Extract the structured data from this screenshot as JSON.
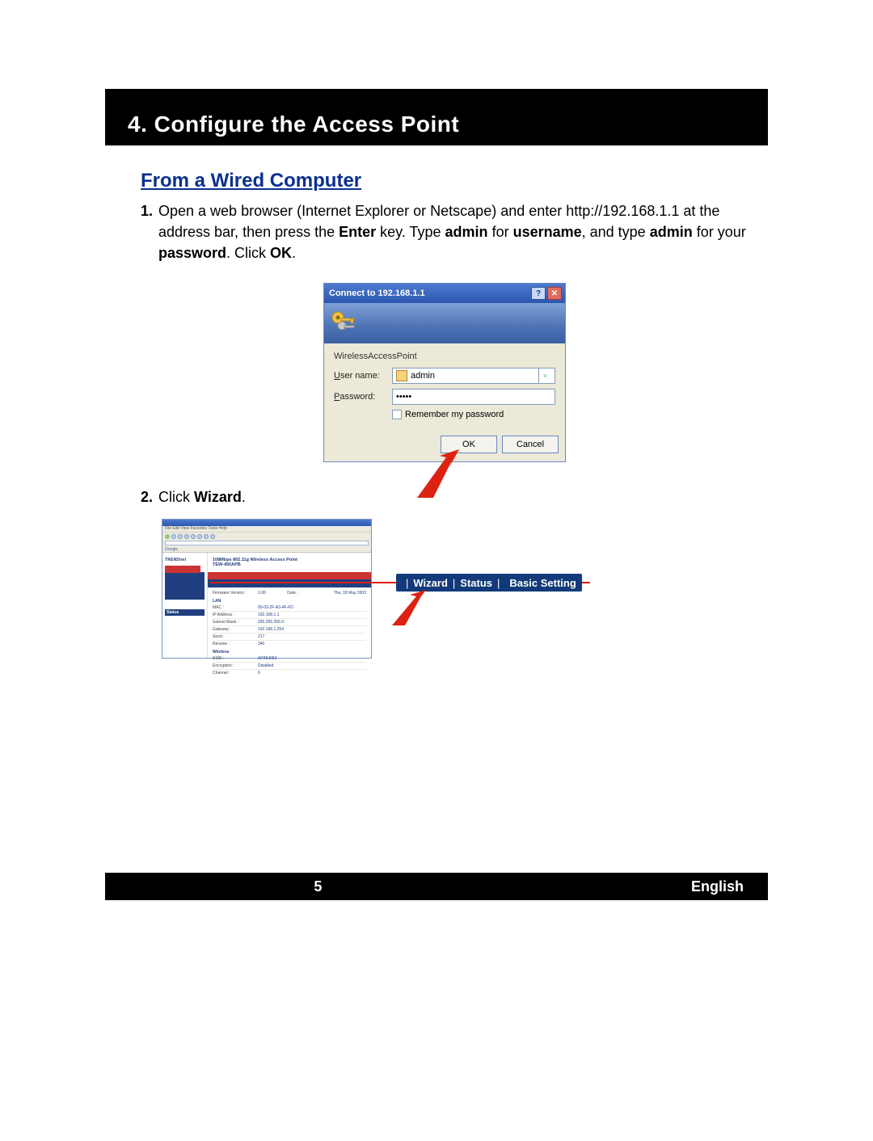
{
  "section": {
    "title": "4. Configure the Access Point",
    "subheading": "From a Wired Computer"
  },
  "steps": {
    "one_num": "1.",
    "one_a": "Open a web browser (Internet Explorer or Netscape) and enter http://192.168.1.1 at the address bar, then press the ",
    "one_b": "Enter",
    "one_c": " key.  Type ",
    "one_d": "admin",
    "one_e": " for ",
    "one_f": "username",
    "one_g": ", and type ",
    "one_h": "admin",
    "one_i": " for your ",
    "one_j": "password",
    "one_k": ".  Click ",
    "one_l": "OK",
    "one_m": ".",
    "two_num": "2.",
    "two_a": "Click ",
    "two_b": "Wizard",
    "two_c": "."
  },
  "dialog": {
    "title": "Connect to 192.168.1.1",
    "help_btn": "?",
    "close_btn": "✕",
    "realm": "WirelessAccessPoint",
    "username_label_u": "U",
    "username_label_rest": "ser name:",
    "password_label_p": "P",
    "password_label_rest": "assword:",
    "username_value": "admin",
    "password_value": "•••••",
    "dropdown_glyph": "˅",
    "remember_r": "R",
    "remember_rest": "emember my password",
    "ok": "OK",
    "cancel": "Cancel"
  },
  "browser": {
    "menu": "File  Edit  View  Favorites  Tools  Help",
    "google": "Google",
    "brand": "TRENDnet",
    "product_title": "108Mbps 802.11g Wireless Access Point",
    "product_model": "TEW-450APB",
    "side_nav_status": "Status",
    "tab_wizard": "Wizard",
    "tab_status": "Status",
    "tab_basic": "Basic Setting",
    "table": {
      "fw_label": "Firmware Version :",
      "fw_value": "1.00",
      "date_label": "Date :",
      "date_value": "Thu, 18 May 2003",
      "lan_header": "LAN",
      "mac_label": "MAC :",
      "mac_value": "00-03-2F-A3-4F-FD",
      "ip_label": "IP Address :",
      "ip_value": "192.168.1.1",
      "mask_label": "Subnet Mask :",
      "mask_value": "255.255.255.0",
      "gw_label": "Gateway :",
      "gw_value": "192.168.1.254",
      "send_label": "Send :",
      "send_value": "217",
      "recv_label": "Receive :",
      "recv_value": "340",
      "wl_header": "Wireless",
      "ssid_label": "SSID :",
      "ssid_value": "AP254052",
      "enc_label": "Encryption :",
      "enc_value": "Disabled",
      "ch_label": "Channel :",
      "ch_value": "6"
    }
  },
  "footer": {
    "page": "5",
    "language": "English"
  }
}
